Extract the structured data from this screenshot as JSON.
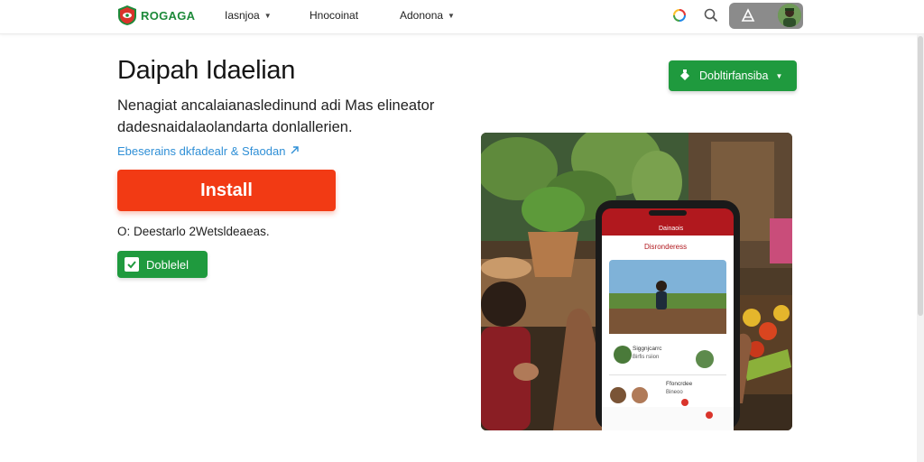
{
  "header": {
    "logo_text": "ROGAGA",
    "nav": [
      {
        "label": "Iasnjoa"
      },
      {
        "label": "Hnocoinat"
      },
      {
        "label": "Adonona"
      }
    ],
    "icons": [
      "sync-icon",
      "search-icon",
      "user-icon"
    ],
    "accent": "#1d8a3a"
  },
  "main": {
    "title": "Daipah Idaelian",
    "description": "Nenagiat ancalaianasledinund adi Mas elineator dadesnaidalaolandarta donlallerien.",
    "link_text": "Ebeserains dkfadealr & Sfaodan",
    "install_label": "Install",
    "note": "O: Deestarlo 2Wetsldeaeas.",
    "checkbox_label": "Doblelel",
    "download_label": "Dobltirfansiba"
  },
  "phone_screen": {
    "status": "Dainaois",
    "title": "Disronderess",
    "row1_title": "Siggnjcarrc",
    "row1_sub": "Birfis rsiion",
    "row2_title": "Ffoncrdee",
    "row2_sub": "Bineoo"
  },
  "colors": {
    "install": "#f23a14",
    "green": "#1f9a3e",
    "link": "#2f8fd6"
  }
}
